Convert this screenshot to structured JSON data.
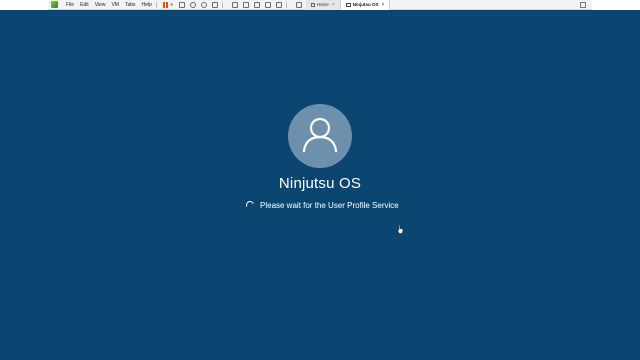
{
  "host_app": {
    "menu": [
      "File",
      "Edit",
      "View",
      "VM",
      "Tabs",
      "Help"
    ],
    "tabs": [
      {
        "label": "Home",
        "icon": "home-icon",
        "active": false
      },
      {
        "label": "Ninjutsu OS",
        "icon": "vm-icon",
        "active": true
      }
    ],
    "close_glyph": "×"
  },
  "login": {
    "username": "Ninjutsu OS",
    "status": "Please wait for the User Profile Service",
    "avatar_icon": "user-silhouette-icon"
  },
  "colors": {
    "background": "#0b4672",
    "avatar": "#6f90ac",
    "text": "#ffffff"
  }
}
